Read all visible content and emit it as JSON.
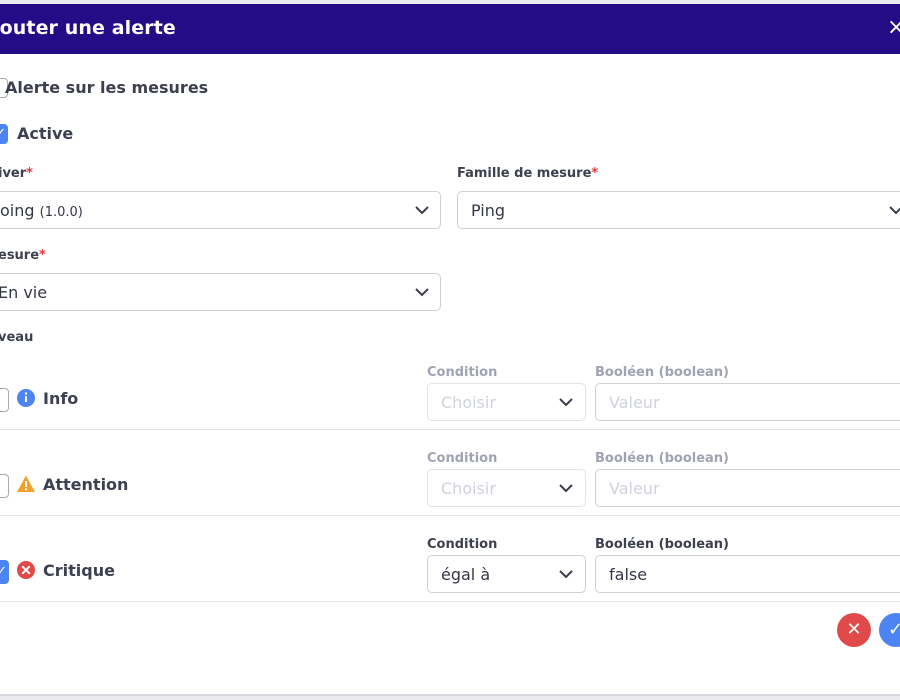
{
  "dialog": {
    "title": "jouter une alerte",
    "close_label": "×"
  },
  "section": {
    "checkbox_label": "Alerte sur les mesures"
  },
  "active": {
    "label": "Active",
    "checked": true
  },
  "driver": {
    "label": "iver",
    "required_mark": "*",
    "value": "oing",
    "version": "(1.0.0)"
  },
  "family": {
    "label": "Famille de mesure",
    "required_mark": "*",
    "value": "Ping"
  },
  "measure": {
    "label": "esure",
    "required_mark": "*",
    "value": "En vie"
  },
  "levels": {
    "label": "veau",
    "rows": [
      {
        "name": "Info",
        "icon": "info-icon",
        "checked": false,
        "condition_label": "Condition",
        "condition_value": "Choisir",
        "bool_label": "Booléen (boolean)",
        "bool_value": "Valeur",
        "color": "#4c84f3",
        "enabled": false
      },
      {
        "name": "Attention",
        "icon": "warning-icon",
        "checked": false,
        "condition_label": "Condition",
        "condition_value": "Choisir",
        "bool_label": "Booléen (boolean)",
        "bool_value": "Valeur",
        "color": "#f0a22e",
        "enabled": false
      },
      {
        "name": "Critique",
        "icon": "error-icon",
        "checked": true,
        "condition_label": "Condition",
        "condition_value": "égal à",
        "bool_label": "Booléen (boolean)",
        "bool_value": "false",
        "color": "#e04a4a",
        "enabled": true
      }
    ]
  },
  "actions": {
    "cancel_icon": "✕",
    "confirm_icon": "✓"
  },
  "colors": {
    "header": "#230c86",
    "accent": "#4c84f3",
    "danger": "#e04a4a"
  }
}
